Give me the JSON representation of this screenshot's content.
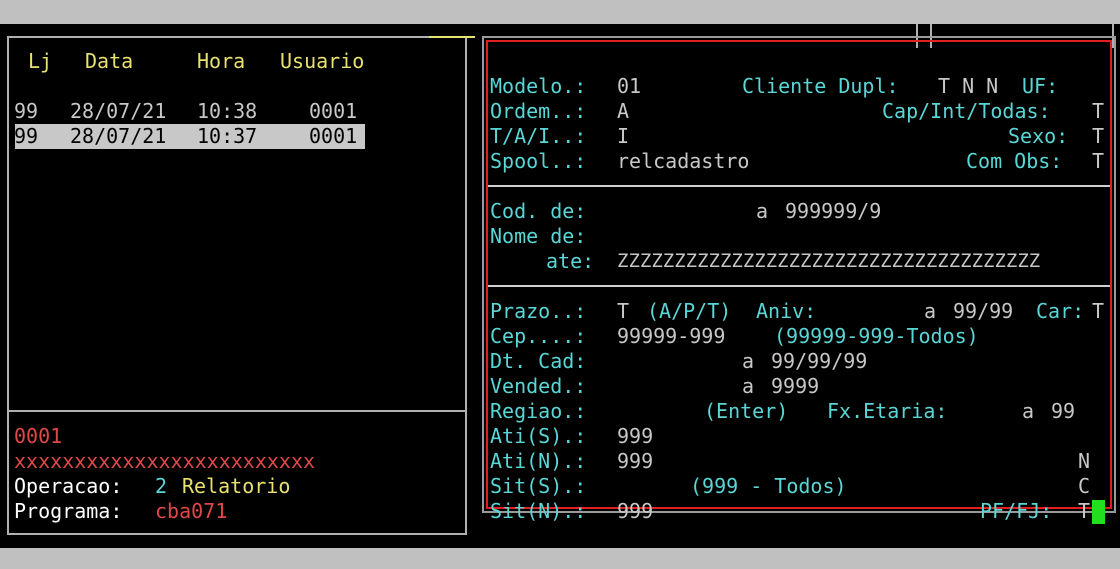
{
  "history": {
    "headers": {
      "loja": "Lj",
      "data": "Data",
      "hora": "Hora",
      "usuario": "Usuario"
    },
    "rows": [
      {
        "loja": "99",
        "data": "28/07/21",
        "hora": "10:38",
        "usuario": "0001",
        "selected": false
      },
      {
        "loja": "99",
        "data": "28/07/21",
        "hora": "10:37",
        "usuario": "0001",
        "selected": true
      }
    ]
  },
  "session": {
    "user_code": "0001",
    "user_name": "xxxxxxxxxxxxxxxxxxxxxxxxx",
    "operacao_label": "Operacao:",
    "operacao_code": "2",
    "operacao_name": "Relatorio",
    "programa_label": "Programa:",
    "programa_value": "cba071"
  },
  "form": {
    "modelo": {
      "label": "Modelo.:",
      "value": "01"
    },
    "cliente_dupl": {
      "label": "Cliente Dupl:",
      "value": "T N N"
    },
    "uf": {
      "label": "UF:",
      "value": ""
    },
    "ordem": {
      "label": "Ordem..:",
      "value": "A"
    },
    "cap_int_todas": {
      "label": "Cap/Int/Todas:",
      "value": "T"
    },
    "tai": {
      "label": "T/A/I..:",
      "value": "I"
    },
    "sexo": {
      "label": "Sexo:",
      "value": "T"
    },
    "spool": {
      "label": "Spool..:",
      "value": "relcadastro"
    },
    "com_obs": {
      "label": "Com Obs:",
      "value": "T"
    },
    "cod": {
      "label": "Cod. de:",
      "to": "a",
      "to_value": "999999/9"
    },
    "nome": {
      "label": "Nome de:"
    },
    "ate": {
      "label": "ate:",
      "value": "ZZZZZZZZZZZZZZZZZZZZZZZZZZZZZZZZZZZZZ"
    },
    "prazo": {
      "label": "Prazo..:",
      "value": "T",
      "hint": "(A/P/T)"
    },
    "aniv": {
      "label": "Aniv:",
      "to": "a",
      "to_value": "99/99"
    },
    "car": {
      "label": "Car:",
      "value": "T"
    },
    "cep": {
      "label": "Cep....:",
      "value": "99999-999",
      "hint": "(99999-999-Todos)"
    },
    "dt_cad": {
      "label": "Dt. Cad:",
      "to": "a",
      "to_value": "99/99/99"
    },
    "vended": {
      "label": "Vended.:",
      "to": "a",
      "to_value": "9999"
    },
    "regiao": {
      "label": "Regiao.:",
      "hint": "(Enter)"
    },
    "fx_etaria": {
      "label": "Fx.Etaria:",
      "to": "a",
      "to_value": "99"
    },
    "ati_s": {
      "label": "Ati(S).:",
      "value": "999"
    },
    "ati_n": {
      "label": "Ati(N).:",
      "value": "999",
      "flag": "N"
    },
    "sit_s": {
      "label": "Sit(S).:",
      "hint": "(999 - Todos)",
      "flag": "C"
    },
    "sit_n": {
      "label": "Sit(N).:",
      "value": "999"
    },
    "pf_fj": {
      "label": "PF/FJ:",
      "value": "T"
    }
  },
  "colors": {
    "label": "#5ad6d6",
    "value": "#c8c8c8",
    "header": "#e8e070",
    "highlight": "#e04848",
    "frame": "#e02020",
    "cursor": "#20e020"
  }
}
